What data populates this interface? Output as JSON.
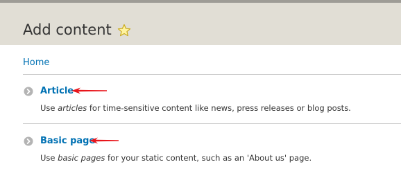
{
  "header": {
    "title": "Add content",
    "star_icon": "star-icon",
    "background": "#e1ded5"
  },
  "breadcrumb": {
    "label": "Home"
  },
  "content_types": [
    {
      "label": "Article",
      "desc_before": "Use ",
      "desc_emphasis": "articles",
      "desc_after": " for time-sensitive content like news, press releases or blog posts.",
      "icon": "chevron-right-circle-icon"
    },
    {
      "label": "Basic page",
      "desc_before": "Use ",
      "desc_emphasis": "basic pages",
      "desc_after": " for your static content, such as an 'About us' page.",
      "icon": "chevron-right-circle-icon"
    }
  ],
  "colors": {
    "link": "#0071b3",
    "annotation_arrow": "#e8151b"
  }
}
